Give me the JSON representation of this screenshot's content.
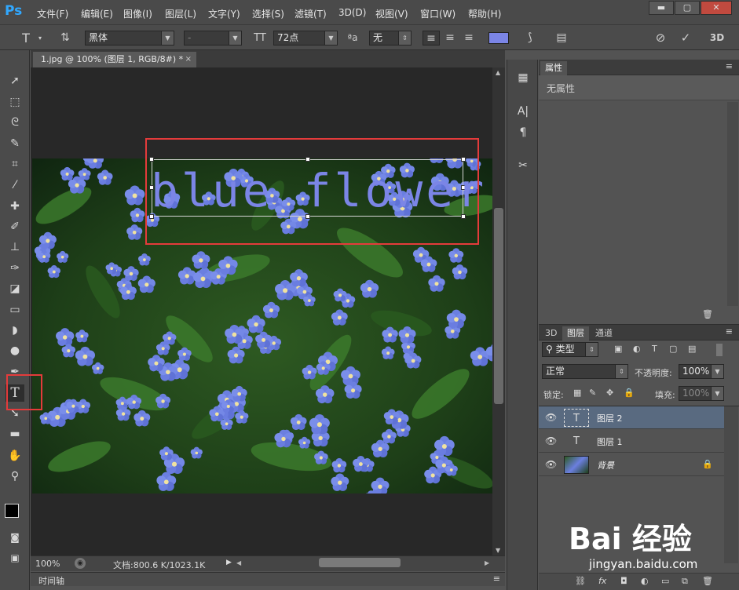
{
  "app": {
    "logo": "Ps",
    "menu": [
      "文件(F)",
      "编辑(E)",
      "图像(I)",
      "图层(L)",
      "文字(Y)",
      "选择(S)",
      "滤镜(T)",
      "3D(D)",
      "视图(V)",
      "窗口(W)",
      "帮助(H)"
    ],
    "window_controls": [
      "▬",
      "▢",
      "✕"
    ]
  },
  "options": {
    "font_family": "黑体",
    "font_style": "-",
    "font_size": "72点",
    "anti_alias": "无",
    "text_color": "#7b85e6",
    "mode_3d": "3D"
  },
  "document": {
    "tab_title": "1.jpg @ 100% (图层 1, RGB/8#) *",
    "tab_close": "×",
    "canvas_text": "blue flower",
    "zoom": "100%",
    "doc_info": "文档:800.6 K/1023.1K",
    "timeline_label": "时间轴"
  },
  "properties": {
    "tab": "属性",
    "empty_text": "无属性"
  },
  "layers": {
    "tabs": [
      "3D",
      "图层",
      "通道"
    ],
    "filter_kind": "类型",
    "blend_mode": "正常",
    "opacity_label": "不透明度:",
    "opacity_value": "100%",
    "lock_label": "锁定:",
    "fill_label": "填充:",
    "fill_value": "100%",
    "items": [
      {
        "name": "图层 2",
        "type": "text",
        "selected": true
      },
      {
        "name": "图层 1",
        "type": "text",
        "selected": false
      },
      {
        "name": "背景",
        "type": "image",
        "selected": false
      }
    ]
  },
  "watermark": {
    "logo": "Bai 经验",
    "url": "jingyan.baidu.com"
  },
  "colors": {
    "highlight": "#e43b3b",
    "selected_layer": "#596a80",
    "ps_blue": "#31a8ff"
  }
}
